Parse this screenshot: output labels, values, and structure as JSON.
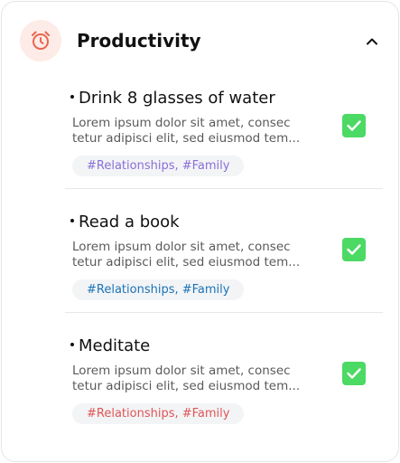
{
  "header": {
    "title": "Productivity",
    "icon": "alarm-clock-icon",
    "toggle_icon": "chevron-up-icon"
  },
  "colors": {
    "icon_bg": "#fdebe7",
    "icon_stroke": "#e8664e",
    "check_bg": "#4cd964"
  },
  "items": [
    {
      "title": "Drink 8 glasses of water",
      "desc_line1": "Lorem ipsum dolor sit amet, consec",
      "desc_line2": "tetur adipisci elit, sed eiusmod tem...",
      "tag": "#Relationships, #Family",
      "tag_color": "#8b6fd6",
      "checked": true
    },
    {
      "title": "Read a book",
      "desc_line1": "Lorem ipsum dolor sit amet, consec",
      "desc_line2": "tetur adipisci elit, sed eiusmod tem...",
      "tag": "#Relationships, #Family",
      "tag_color": "#1a73b8",
      "checked": true
    },
    {
      "title": "Meditate",
      "desc_line1": "Lorem ipsum dolor sit amet, consec",
      "desc_line2": "tetur adipisci elit, sed eiusmod tem...",
      "tag": "#Relationships, #Family",
      "tag_color": "#e05555",
      "checked": true
    }
  ]
}
